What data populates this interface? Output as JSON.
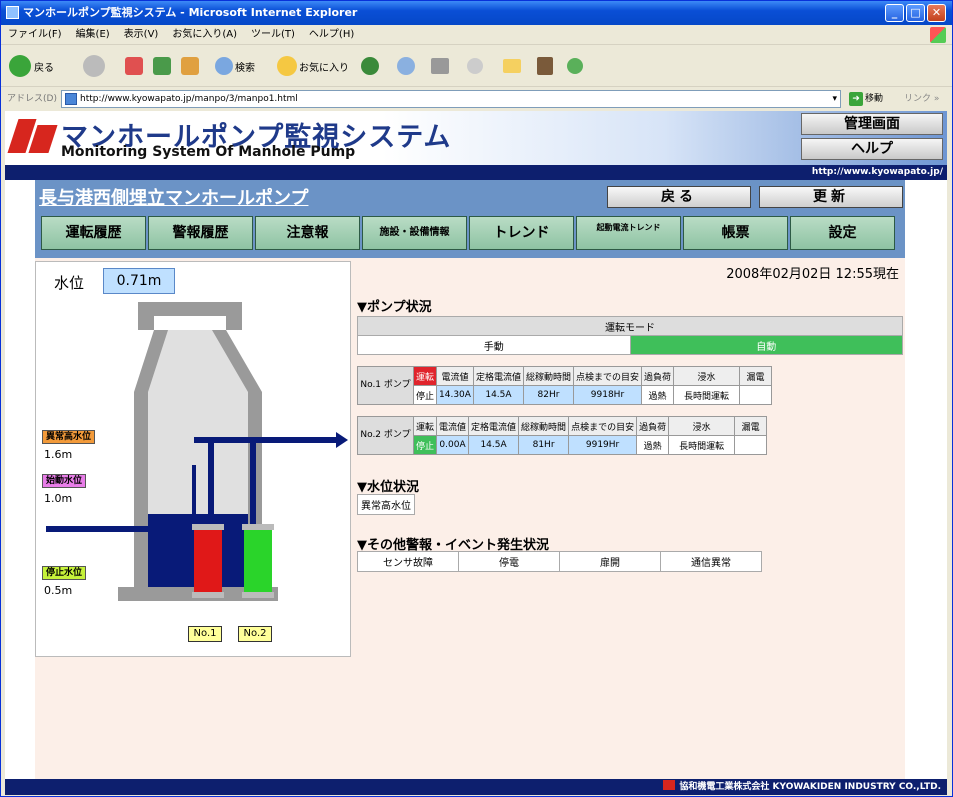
{
  "window": {
    "title": "マンホールポンプ監視システム - Microsoft Internet Explorer",
    "minimize": "_",
    "maximize": "□",
    "close": "✕"
  },
  "menu": [
    "ファイル(F)",
    "編集(E)",
    "表示(V)",
    "お気に入り(A)",
    "ツール(T)",
    "ヘルプ(H)"
  ],
  "toolbar": {
    "back": "戻る",
    "search": "検索",
    "favorites": "お気に入り"
  },
  "address": {
    "label": "アドレス(D)",
    "url": "http://www.kyowapato.jp/manpo/3/manpo1.html",
    "go": "移動",
    "links": "リンク »"
  },
  "header": {
    "system_name_jp": "マンホールポンプ監視システム",
    "system_name_en": "Monitoring System Of Manhole Pump",
    "admin_button": "管理画面",
    "help_button": "ヘルプ",
    "site_url": "http://www.kyowapato.jp/"
  },
  "nav": {
    "site_title": "長与港西側埋立マンホールポンプ",
    "back_button": "戻る",
    "refresh_button": "更新",
    "tabs": [
      "運転履歴",
      "警報履歴",
      "注意報",
      "施設・設備情報",
      "トレンド",
      "起動電流トレンド",
      "帳票",
      "設定"
    ]
  },
  "status": {
    "datetime": "2008年02月02日 12:55現在"
  },
  "water_level": {
    "label": "水位",
    "value": "0.71m",
    "levels": [
      {
        "name": "異常高水位",
        "value": "1.6m",
        "color": "#f29a3a"
      },
      {
        "name": "始動水位",
        "value": "1.0m",
        "color": "#e87de8"
      },
      {
        "name": "停止水位",
        "value": "0.5m",
        "color": "#c6f23a"
      }
    ],
    "pump_labels": [
      "No.1",
      "No.2"
    ]
  },
  "pump_status": {
    "heading": "▼ポンプ状況",
    "mode_label": "運転モード",
    "mode_manual": "手動",
    "mode_auto": "自動",
    "columns": [
      "電流値",
      "定格電流値",
      "総稼動時間",
      "点検までの目安",
      "過負荷",
      "浸水",
      "漏電"
    ],
    "pumps": [
      {
        "name": "No.1 ポンプ",
        "run": "運転",
        "stop": "停止",
        "current": "14.30A",
        "rated": "14.5A",
        "hours": "82Hr",
        "inspection": "9918Hr",
        "overload": "過熱",
        "flood": "長時間運転",
        "leak": "",
        "running": true
      },
      {
        "name": "No.2 ポンプ",
        "run": "運転",
        "stop": "停止",
        "current": "0.00A",
        "rated": "14.5A",
        "hours": "81Hr",
        "inspection": "9919Hr",
        "overload": "過熱",
        "flood": "長時間運転",
        "leak": "",
        "running": false
      }
    ]
  },
  "water_status": {
    "heading": "▼水位状況",
    "items": [
      "異常高水位"
    ]
  },
  "events": {
    "heading": "▼その他警報・イベント発生状況",
    "items": [
      "センサ故障",
      "停電",
      "扉開",
      "通信異常"
    ]
  },
  "footer": {
    "company": "協和機電工業株式会社 KYOWAKIDEN INDUSTRY CO.,LTD."
  }
}
